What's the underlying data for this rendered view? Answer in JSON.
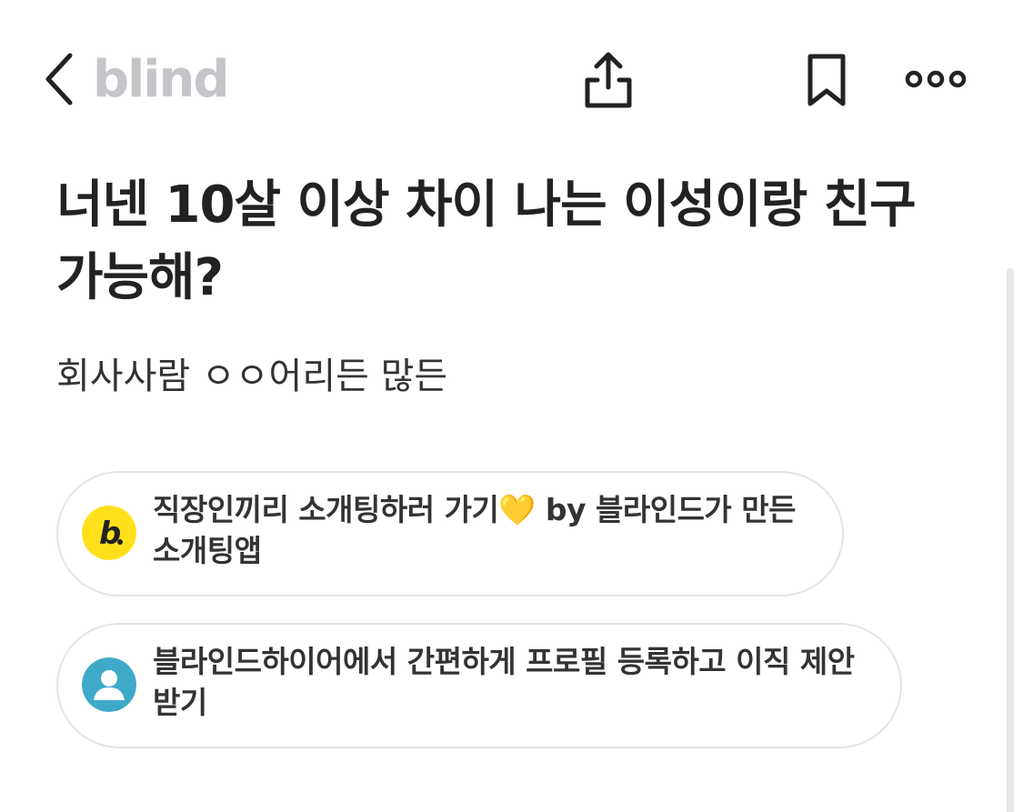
{
  "nav": {
    "logo": "blind",
    "icons": {
      "back": "chevron-left-icon",
      "share": "share-icon",
      "bookmark": "bookmark-icon",
      "more": "more-horizontal-icon"
    }
  },
  "post": {
    "title": "너넨 10살 이상 차이 나는 이성이랑 친구 가능해?",
    "body": "회사사람 ㅇㅇ어리든 많든"
  },
  "cards": [
    {
      "text": "직장인끼리 소개팅하러 가기💛 by 블라인드가 만든 소개팅앱",
      "icon": "blind-b-logo-icon",
      "icon_color": "#FFE01B"
    },
    {
      "text": "블라인드하이어에서 간편하게 프로필 등록하고 이직 제안 받기",
      "icon": "user-profile-icon",
      "icon_color": "#3FA9C9"
    }
  ],
  "colors": {
    "logo": "#C4C5C9",
    "title": "#222222",
    "card_border": "#E3E4E6"
  }
}
